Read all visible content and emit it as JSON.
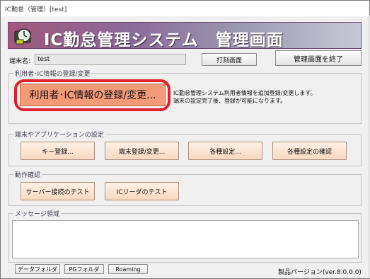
{
  "window": {
    "title": "IC勤怠（管理）[test]"
  },
  "banner": {
    "title": "IC勤怠管理システム　管理画面",
    "logo_icon": "clock-card-icon"
  },
  "terminal": {
    "label": "端末名:",
    "value": "test"
  },
  "toolbar": {
    "print_label": "打刻画面",
    "exit_label": "管理画面を終了"
  },
  "registration": {
    "legend": "利用者･IC情報の登録/変更",
    "button_label": "利用者･IC情報の登録/変更...",
    "description_line1": "IC勤怠管理システム利用者情報を追加登録/変更します。",
    "description_line2": "端末の設定完了後、登録が可能になります。"
  },
  "settings": {
    "legend": "端末やアプリケーションの設定",
    "key_register": "キー登録...",
    "terminal_register": "端末登録/変更...",
    "various_settings": "各種設定...",
    "confirm_settings": "各種設定の確認"
  },
  "operation": {
    "legend": "動作確認",
    "server_test": "サーバー接続のテスト",
    "ic_reader_test": "ICリーダのテスト"
  },
  "message": {
    "legend": "メッセージ領域"
  },
  "footer": {
    "data_folder": "データフォルダ",
    "pg_folder": "PGフォルダ",
    "roaming": "Roaming",
    "version": "製品バージョン(ver.8.0.0.0)"
  },
  "colors": {
    "banner_start": "#a0587a",
    "highlight": "#e0202a",
    "primary_button": "#f39a78"
  }
}
